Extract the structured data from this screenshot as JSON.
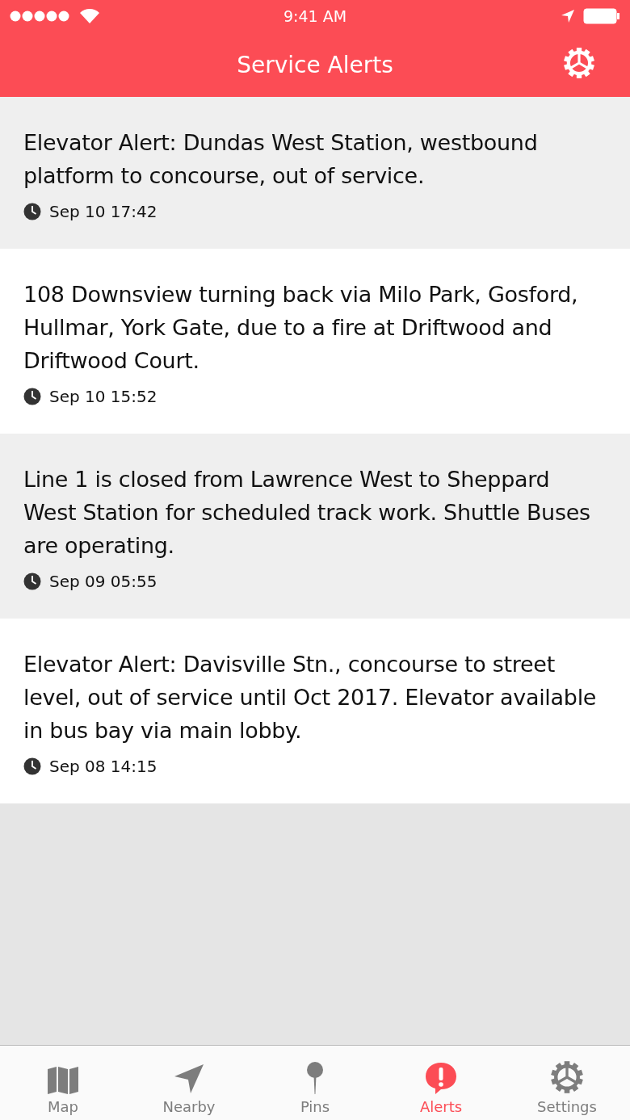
{
  "status_bar": {
    "time": "9:41 AM"
  },
  "nav": {
    "title": "Service Alerts"
  },
  "alerts": [
    {
      "message": "Elevator Alert: Dundas West Station, westbound platform to concourse, out of service.",
      "time": "Sep 10 17:42"
    },
    {
      "message": "108 Downsview turning back via Milo Park, Gosford, Hullmar, York Gate, due to a fire at Driftwood and Driftwood Court.",
      "time": "Sep 10 15:52"
    },
    {
      "message": "Line 1 is closed from Lawrence West to Sheppard West Station for scheduled track work. Shuttle Buses are operating.",
      "time": "Sep 09 05:55"
    },
    {
      "message": "Elevator Alert: Davisville Stn., concourse to street level, out of service until Oct 2017. Elevator available in bus bay via main lobby.",
      "time": "Sep 08 14:15"
    }
  ],
  "tabs": [
    {
      "kind": "map",
      "label": "Map",
      "selected": false
    },
    {
      "kind": "nearby",
      "label": "Nearby",
      "selected": false
    },
    {
      "kind": "pins",
      "label": "Pins",
      "selected": false
    },
    {
      "kind": "alerts",
      "label": "Alerts",
      "selected": true
    },
    {
      "kind": "settings",
      "label": "Settings",
      "selected": false
    }
  ]
}
